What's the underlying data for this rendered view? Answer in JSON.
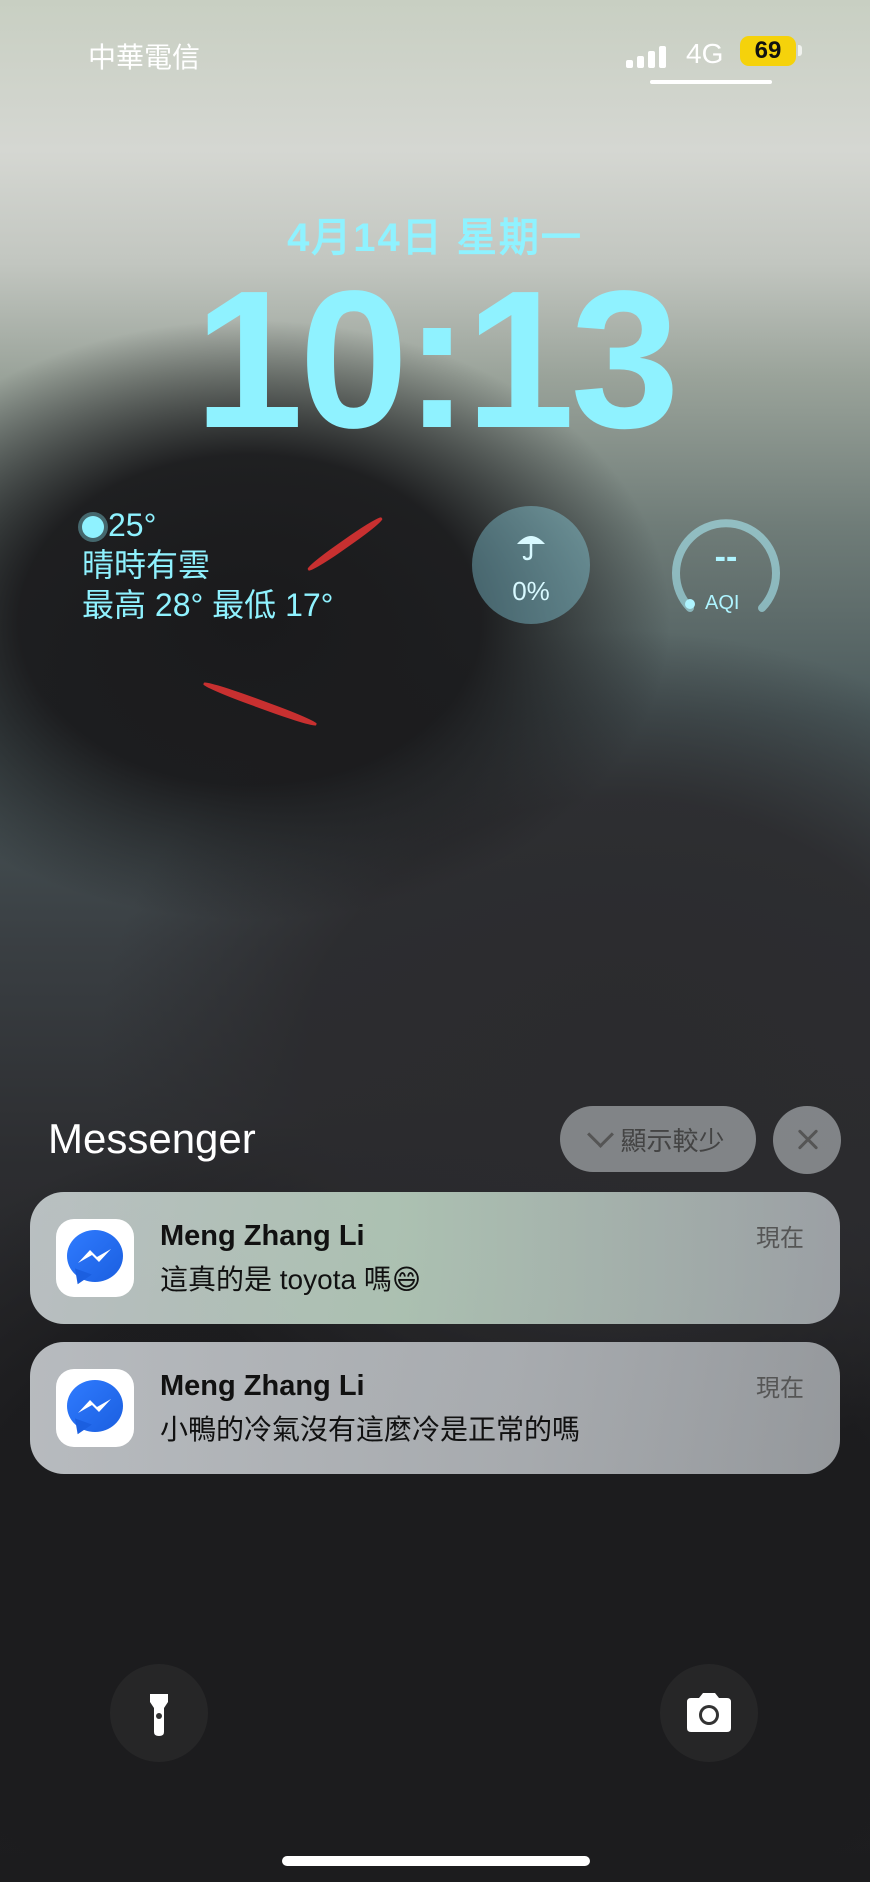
{
  "status_bar": {
    "carrier": "中華電信",
    "network": "4G",
    "battery": "69"
  },
  "lock_screen": {
    "date": "4月14日 星期一",
    "time": "10:13"
  },
  "widgets": {
    "weather": {
      "temperature": "25°",
      "condition": "晴時有雲",
      "high_low": "最高 28° 最低 17°",
      "icon": "sun-icon"
    },
    "rain": {
      "value": "0%",
      "icon": "umbrella-icon"
    },
    "aqi": {
      "value": "--",
      "label": "AQI"
    }
  },
  "notifications": {
    "group_title": "Messenger",
    "show_less_label": "顯示較少",
    "items": [
      {
        "sender": "Meng Zhang Li",
        "message": "這真的是 toyota 嗎😄",
        "time": "現在",
        "app_icon": "messenger-icon"
      },
      {
        "sender": "Meng Zhang Li",
        "message": "小鴨的冷氣沒有這麼冷是正常的嗎",
        "time": "現在",
        "app_icon": "messenger-icon"
      }
    ]
  },
  "quick_actions": {
    "left_icon": "flashlight-icon",
    "right_icon": "camera-icon"
  }
}
